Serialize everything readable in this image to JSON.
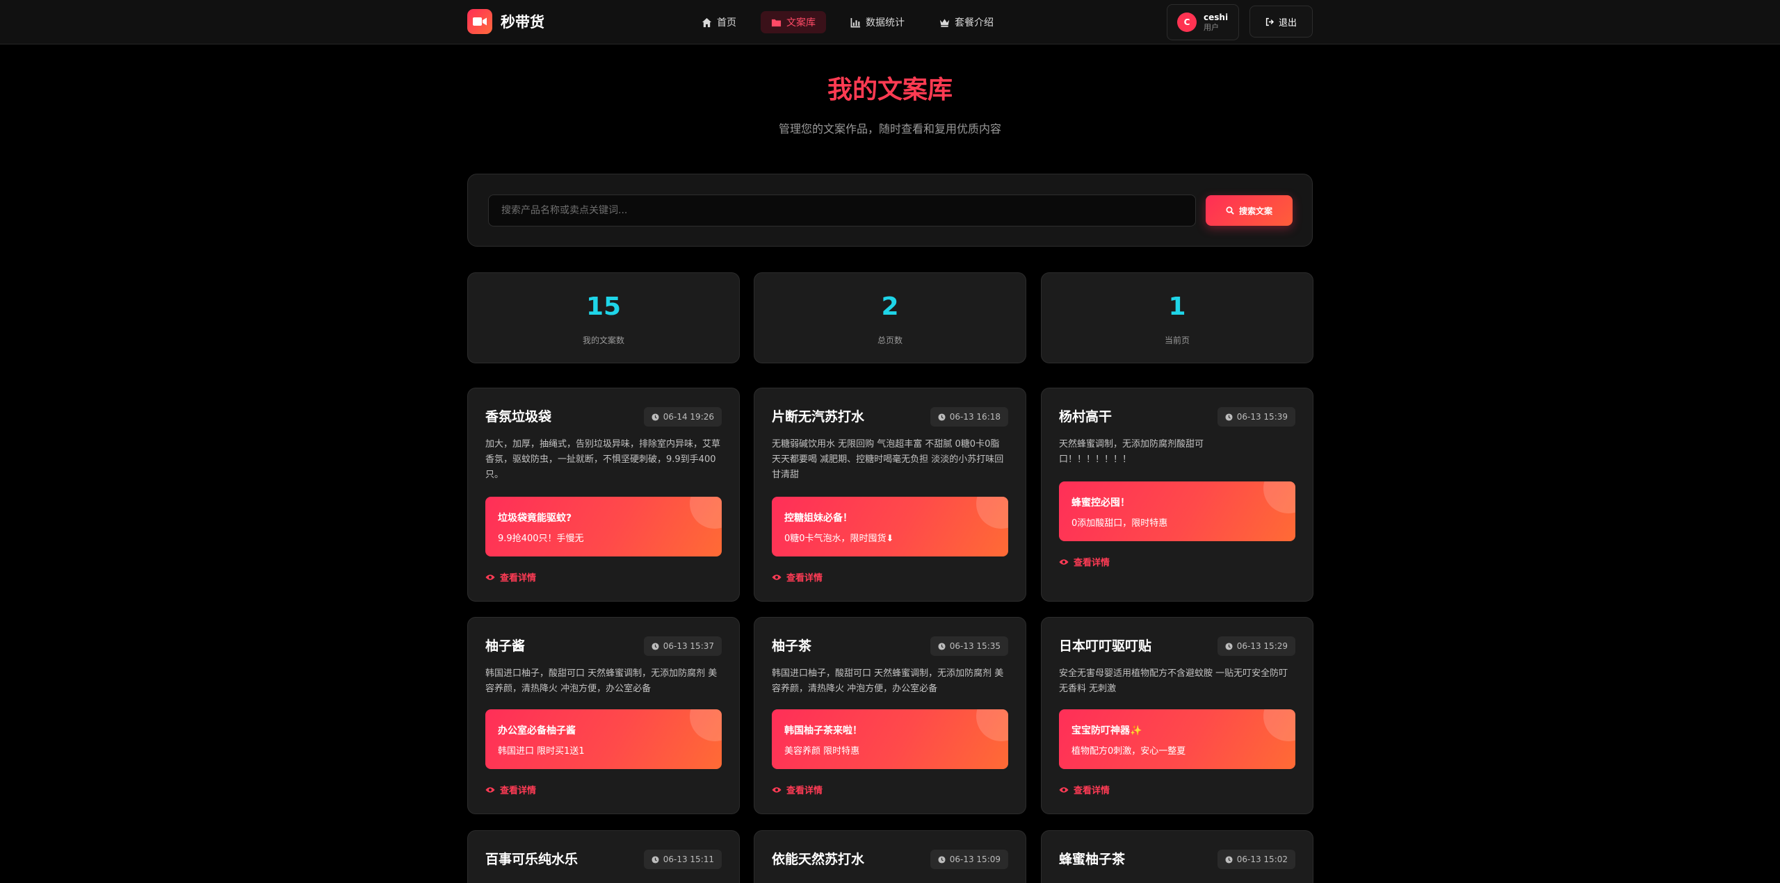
{
  "header": {
    "brand": "秒带货",
    "nav": [
      {
        "label": "首页",
        "icon": "home-icon"
      },
      {
        "label": "文案库",
        "icon": "folder-icon",
        "active": true
      },
      {
        "label": "数据统计",
        "icon": "chart-icon"
      },
      {
        "label": "套餐介绍",
        "icon": "crown-icon"
      }
    ],
    "user": {
      "avatar_letter": "C",
      "name": "ceshi",
      "role": "用户"
    },
    "logout_label": "退出"
  },
  "hero": {
    "title": "我的文案库",
    "subtitle": "管理您的文案作品，随时查看和复用优质内容"
  },
  "search": {
    "placeholder": "搜索产品名称或卖点关键词...",
    "value": "",
    "button_label": "搜索文案"
  },
  "stats": [
    {
      "value": "15",
      "label": "我的文案数"
    },
    {
      "value": "2",
      "label": "总页数"
    },
    {
      "value": "1",
      "label": "当前页"
    }
  ],
  "detail_label": "查看详情",
  "cards": [
    {
      "title": "香氛垃圾袋",
      "time": "06-14 19:26",
      "desc": "加大，加厚，抽绳式，告别垃圾异味，排除室内异味，艾草香氛，驱蚊防虫，一扯就断，不惧坚硬刺破，9.9到手400只。",
      "promo_title": "垃圾袋竟能驱蚊?",
      "promo_text": "9.9抢400只！手慢无"
    },
    {
      "title": "片断无汽苏打水",
      "time": "06-13 16:18",
      "desc": "无糖弱碱饮用水 无限回购 气泡超丰富 不甜腻 0糖0卡0脂 天天都要喝 减肥期、控糖时喝毫无负担 淡淡的小苏打味回甘清甜",
      "promo_title": "控糖姐妹必备！",
      "promo_text": "0糖0卡气泡水，限时囤货⬇"
    },
    {
      "title": "杨村高干",
      "time": "06-13 15:39",
      "desc": "天然蜂蜜调制，无添加防腐剂酸甜可口！！！！！！！",
      "promo_title": "蜂蜜控必囤！",
      "promo_text": "0添加酸甜口，限时特惠"
    },
    {
      "title": "柚子酱",
      "time": "06-13 15:37",
      "desc": "韩国进口柚子，酸甜可口 天然蜂蜜调制，无添加防腐剂 美容养颜，清热降火 冲泡方便，办公室必备",
      "promo_title": "办公室必备柚子酱",
      "promo_text": "韩国进口 限时买1送1"
    },
    {
      "title": "柚子茶",
      "time": "06-13 15:35",
      "desc": "韩国进口柚子，酸甜可口 天然蜂蜜调制，无添加防腐剂 美容养颜，清热降火 冲泡方便，办公室必备",
      "promo_title": "韩国柚子茶来啦！",
      "promo_text": "美容养颜 限时特惠"
    },
    {
      "title": "日本叮叮驱叮贴",
      "time": "06-13 15:29",
      "desc": "安全无害母婴适用植物配方不含避蚊胺 一贴无叮安全防叮 无香料 无刺激",
      "promo_title": "宝宝防叮神器✨",
      "promo_text": "植物配方0刺激，安心一整夏"
    },
    {
      "title": "百事可乐纯水乐",
      "time": "06-13 15:11"
    },
    {
      "title": "依能天然苏打水",
      "time": "06-13 15:09"
    },
    {
      "title": "蜂蜜柚子茶",
      "time": "06-13 15:02"
    }
  ]
}
